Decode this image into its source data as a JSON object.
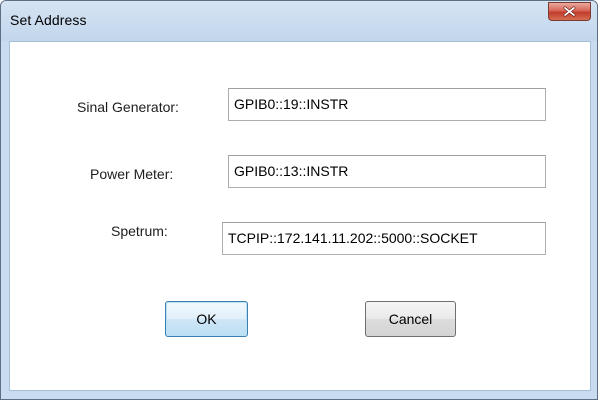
{
  "window": {
    "title": "Set Address"
  },
  "form": {
    "signal_generator": {
      "label": "Sinal Generator:",
      "value": "GPIB0::19::INSTR"
    },
    "power_meter": {
      "label": "Power Meter:",
      "value": "GPIB0::13::INSTR"
    },
    "spectrum": {
      "label": "Spetrum:",
      "value": "TCPIP::172.141.11.202::5000::SOCKET"
    }
  },
  "buttons": {
    "ok": "OK",
    "cancel": "Cancel"
  },
  "icons": {
    "close": "close-icon"
  },
  "colors": {
    "titlebar": "#c9dbee",
    "close_button": "#c13c2c",
    "ok_border": "#3c7fb1"
  }
}
